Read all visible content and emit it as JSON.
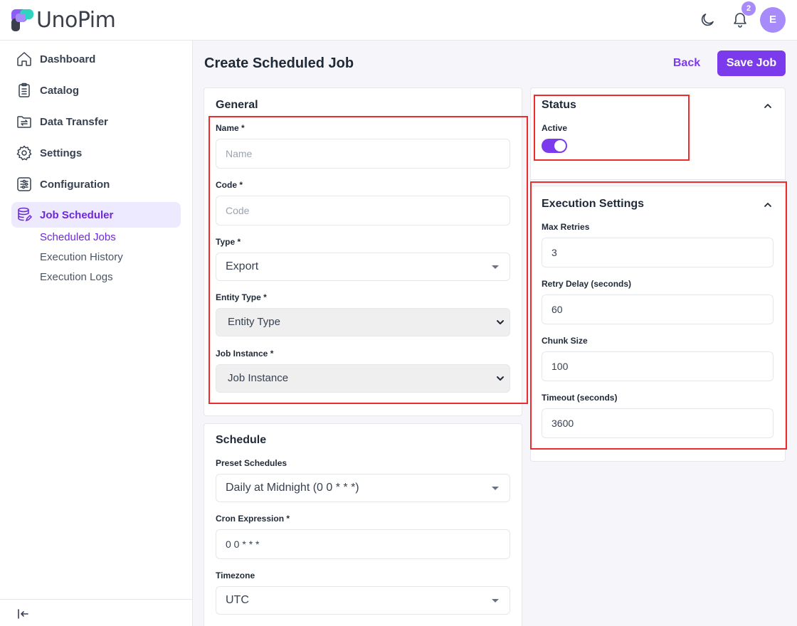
{
  "app": {
    "name": "UnoPim"
  },
  "header": {
    "notification_count": "2",
    "avatar_initial": "E"
  },
  "sidebar": {
    "items": [
      {
        "label": "Dashboard",
        "icon": "home-icon"
      },
      {
        "label": "Catalog",
        "icon": "clipboard-list-icon"
      },
      {
        "label": "Data Transfer",
        "icon": "folder-transfer-icon"
      },
      {
        "label": "Settings",
        "icon": "gear-icon"
      },
      {
        "label": "Configuration",
        "icon": "sliders-icon"
      },
      {
        "label": "Job Scheduler",
        "icon": "database-edit-icon"
      }
    ],
    "subitems": [
      "Scheduled Jobs",
      "Execution History",
      "Execution Logs"
    ]
  },
  "page": {
    "title": "Create Scheduled Job",
    "back_label": "Back",
    "save_label": "Save Job"
  },
  "general": {
    "title": "General",
    "name_label": "Name *",
    "name_placeholder": "Name",
    "code_label": "Code *",
    "code_placeholder": "Code",
    "type_label": "Type *",
    "type_value": "Export",
    "entity_type_label": "Entity Type *",
    "entity_type_value": "Entity Type",
    "job_instance_label": "Job Instance *",
    "job_instance_value": "Job Instance"
  },
  "schedule": {
    "title": "Schedule",
    "preset_label": "Preset Schedules",
    "preset_value": "Daily at Midnight (0 0 * * *)",
    "cron_label": "Cron Expression *",
    "cron_value": "0 0 * * *",
    "timezone_label": "Timezone",
    "timezone_value": "UTC"
  },
  "status": {
    "title": "Status",
    "active_label": "Active",
    "active": true
  },
  "execution": {
    "title": "Execution Settings",
    "max_retries_label": "Max Retries",
    "max_retries_value": "3",
    "retry_delay_label": "Retry Delay (seconds)",
    "retry_delay_value": "60",
    "chunk_size_label": "Chunk Size",
    "chunk_size_value": "100",
    "timeout_label": "Timeout (seconds)",
    "timeout_value": "3600"
  },
  "colors": {
    "accent": "#7c3aed",
    "highlight_box": "#ef2b2b"
  }
}
